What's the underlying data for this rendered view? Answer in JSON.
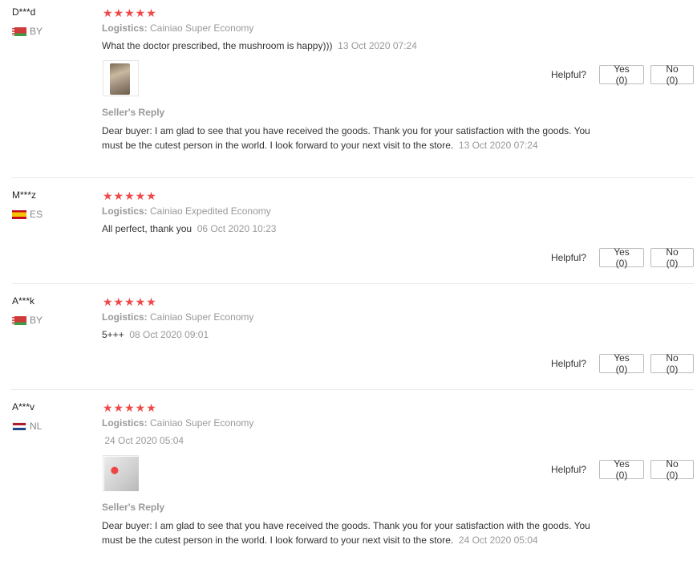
{
  "helpful_label": "Helpful?",
  "logistics_label": "Logistics:",
  "reviews": [
    {
      "user": "D***d",
      "country": "BY",
      "stars": "★★★★★",
      "logistics": "Cainiao Super Economy",
      "feedback": "What the doctor prescribed, the mushroom is happy)))",
      "date": "13 Oct 2020 07:24",
      "yes": "Yes (0)",
      "no": "No (0)",
      "reply_title": "Seller's Reply",
      "reply_text": "Dear buyer: I am glad to see that you have received the goods. Thank you for your satisfaction with the goods. You must be the cutest person in the world. I look forward to your next visit to the store.",
      "reply_date": "13 Oct 2020 07:24"
    },
    {
      "user": "M***z",
      "country": "ES",
      "stars": "★★★★★",
      "logistics": "Cainiao Expedited Economy",
      "feedback": "All perfect, thank you",
      "date": "06 Oct 2020 10:23",
      "yes": "Yes (0)",
      "no": "No (0)"
    },
    {
      "user": "A***k",
      "country": "BY",
      "stars": "★★★★★",
      "logistics": "Cainiao Super Economy",
      "feedback": "5+++",
      "date": "08 Oct 2020 09:01",
      "yes": "Yes (0)",
      "no": "No (0)"
    },
    {
      "user": "A***v",
      "country": "NL",
      "stars": "★★★★★",
      "logistics": "Cainiao Super Economy",
      "feedback": "",
      "date": "24 Oct 2020 05:04",
      "yes": "Yes (0)",
      "no": "No (0)",
      "reply_title": "Seller's Reply",
      "reply_text": "Dear buyer: I am glad to see that you have received the goods. Thank you for your satisfaction with the goods. You must be the cutest person in the world. I look forward to your next visit to the store.",
      "reply_date": "24 Oct 2020 05:04"
    }
  ]
}
